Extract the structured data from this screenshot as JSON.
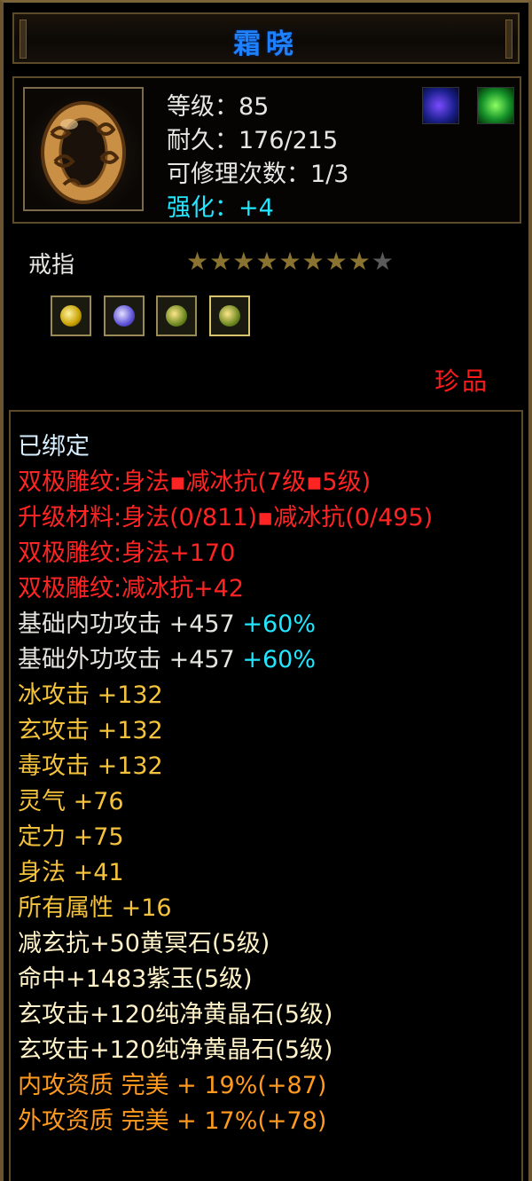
{
  "title": "霜晓",
  "item": {
    "icon_name": "gold-ring-icon",
    "level_line": "等级：85",
    "durability_line": "耐久：176/215",
    "repair_line": "可修理次数：1/3",
    "enhance_line": "强化：+4",
    "buffs": [
      "blue-dragon-buff-icon",
      "green-dragon-buff-icon"
    ],
    "type": "戒指",
    "stars": {
      "filled": 8,
      "total": 9
    },
    "gems": [
      "yellow-gem-icon",
      "purple-gem-icon",
      "green-gold-gem-icon",
      "green-gold-gem-icon"
    ],
    "rarity": "珍品"
  },
  "details": {
    "bound": "已绑定",
    "engrave_summary": "双极雕纹:身法▪减冰抗(7级▪5级)",
    "upgrade_material": "升级材料:身法(0/811)▪减冰抗(0/495)",
    "engrave_1": "双极雕纹:身法+170",
    "engrave_2": "双极雕纹:减冰抗+42",
    "base_inner": {
      "label": "基础内功攻击 +457",
      "bonus": "+60%"
    },
    "base_outer": {
      "label": "基础外功攻击 +457",
      "bonus": "+60%"
    },
    "attrs": [
      "冰攻击 +132",
      "玄攻击 +132",
      "毒攻击 +132",
      "灵气 +76",
      "定力 +75",
      "身法 +41",
      "所有属性 +16"
    ],
    "gem_lines": [
      "减玄抗+50黄冥石(5级)",
      "命中+1483紫玉(5级)",
      "玄攻击+120纯净黄晶石(5级)",
      "玄攻击+120纯净黄晶石(5级)"
    ],
    "quality_inner": "内攻资质 完美 + 19%(+87)",
    "quality_outer": "外攻资质 完美 + 17%(+78)"
  },
  "colors": {
    "title": "#1e82ff",
    "enhance": "#23e6ff",
    "engrave": "#ff2424",
    "attribute": "#f5c23b",
    "gem_line": "#fff2c8",
    "quality": "#ff9a1e",
    "rarity": "#ff1a1a"
  }
}
